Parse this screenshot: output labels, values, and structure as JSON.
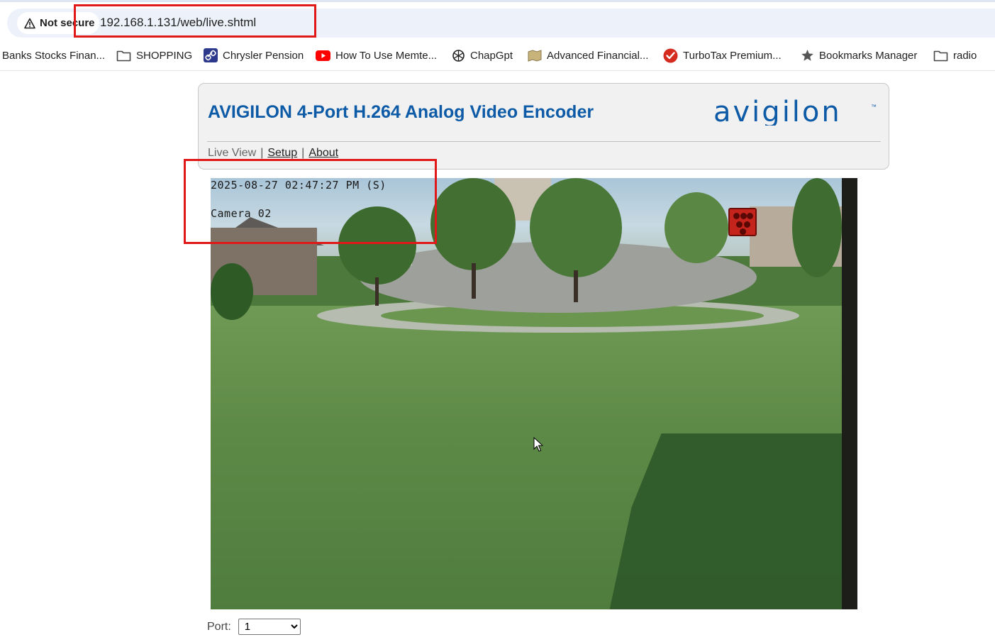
{
  "browser": {
    "security_label": "Not secure",
    "url": "192.168.1.131/web/live.shtml"
  },
  "bookmarks": [
    {
      "label": "Banks Stocks Finan...",
      "icon": "none"
    },
    {
      "label": "SHOPPING",
      "icon": "folder-icon"
    },
    {
      "label": "Chrysler Pension",
      "icon": "link-icon"
    },
    {
      "label": "How To Use Memte...",
      "icon": "youtube-icon"
    },
    {
      "label": "ChapGpt",
      "icon": "openai-icon"
    },
    {
      "label": "Advanced Financial...",
      "icon": "map-icon"
    },
    {
      "label": "TurboTax Premium...",
      "icon": "turbotax-check-icon"
    },
    {
      "label": "Bookmarks Manager",
      "icon": "star-icon"
    },
    {
      "label": "radio",
      "icon": "folder-icon"
    }
  ],
  "header": {
    "title": "AVIGILON 4-Port H.264 Analog Video Encoder",
    "logo_text": "avigilon",
    "logo_tm": "™"
  },
  "nav": {
    "live_view": "Live View",
    "setup": "Setup",
    "about": "About",
    "separator": "|"
  },
  "camera": {
    "timestamp": "2025-08-27 02:47:27 PM (S)",
    "name": "Camera 02"
  },
  "port": {
    "label": "Port:",
    "selected": "1"
  },
  "colors": {
    "brand_blue": "#0d5ba7",
    "annotation_red": "#e01818",
    "omnibox_bg": "#edf1fa"
  }
}
